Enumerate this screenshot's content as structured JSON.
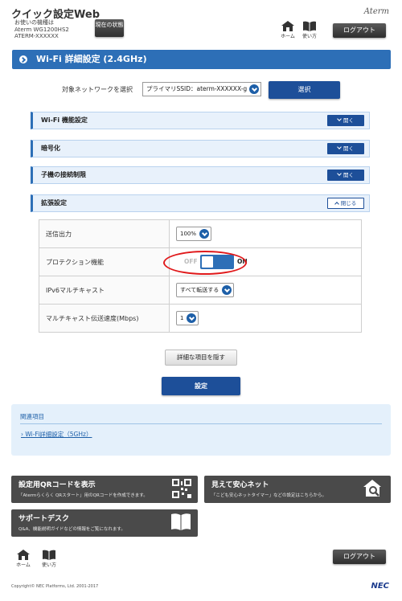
{
  "header": {
    "app_title": "クイック設定Web",
    "model_caption": "お使いの機種は",
    "model_name": "Aterm WG1200HS2",
    "device_id": "ATERM-XXXXXX",
    "status_button": "現在の状態",
    "brand": "Aterm",
    "home_label": "ホーム",
    "help_label": "使い方",
    "logout_label": "ログアウト"
  },
  "page_title": "Wi-Fi 詳細設定 (2.4GHz)",
  "network": {
    "label": "対象ネットワークを選択",
    "selected": "プライマリSSID：aterm-XXXXXX-g",
    "select_button": "選択"
  },
  "accordions": [
    {
      "label": "Wi-Fi 機能設定",
      "button": "開く"
    },
    {
      "label": "暗号化",
      "button": "開く"
    },
    {
      "label": "子機の接続制限",
      "button": "開く"
    },
    {
      "label": "拡張設定",
      "button": "閉じる"
    }
  ],
  "settings": {
    "tx_power_label": "送信出力",
    "tx_power_value": "100%",
    "protection_label": "プロテクション機能",
    "protection_off": "OFF",
    "protection_on": "ON",
    "protection_enabled": true,
    "ipv6_label": "IPv6マルチキャスト",
    "ipv6_value": "すべて転送する",
    "mcast_label": "マルチキャスト伝送速度(Mbps)",
    "mcast_value": "1"
  },
  "actions": {
    "hide_details": "詳細な項目を隠す",
    "apply": "設定"
  },
  "related": {
    "title": "関連項目",
    "link": "Wi-Fi詳細設定（5GHz）"
  },
  "tiles": [
    {
      "title": "設定用QRコードを表示",
      "sub": "「Atermらくらく QRスタート」用のQRコードを作成できます。"
    },
    {
      "title": "見えて安心ネット",
      "sub": "「こども安心ネットタイマー」などの設定はこちらから。"
    },
    {
      "title": "サポートデスク",
      "sub": "Q&A、機能説明ガイドなどの情報をご覧になれます。"
    }
  ],
  "footer": {
    "home_label": "ホーム",
    "help_label": "使い方",
    "logout_label": "ログアウト",
    "copyright": "Copyright© NEC Platforms, Ltd. 2001-2017",
    "nec": "NEC"
  },
  "colors": {
    "primary_blue": "#2d6fb7",
    "button_blue": "#1d4f99",
    "highlight_red": "#e0191b",
    "tile_gray": "#4a4a4a"
  }
}
